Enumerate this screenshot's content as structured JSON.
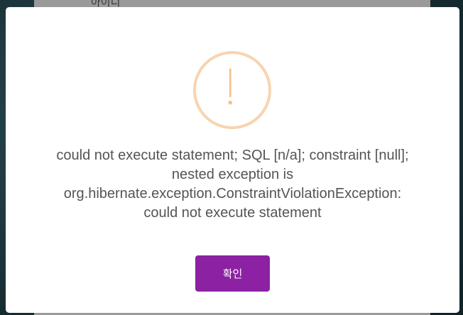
{
  "background": {
    "label": "아이디"
  },
  "modal": {
    "icon": "warning-icon",
    "icon_color": "#f8d4b0",
    "message_lines": [
      "could not execute statement; SQL [n/a]; constraint [null];",
      "nested exception is",
      "org.hibernate.exception.ConstraintViolationException:",
      "could not execute statement"
    ],
    "confirm_label": "확인",
    "confirm_color": "#8c22a3"
  }
}
